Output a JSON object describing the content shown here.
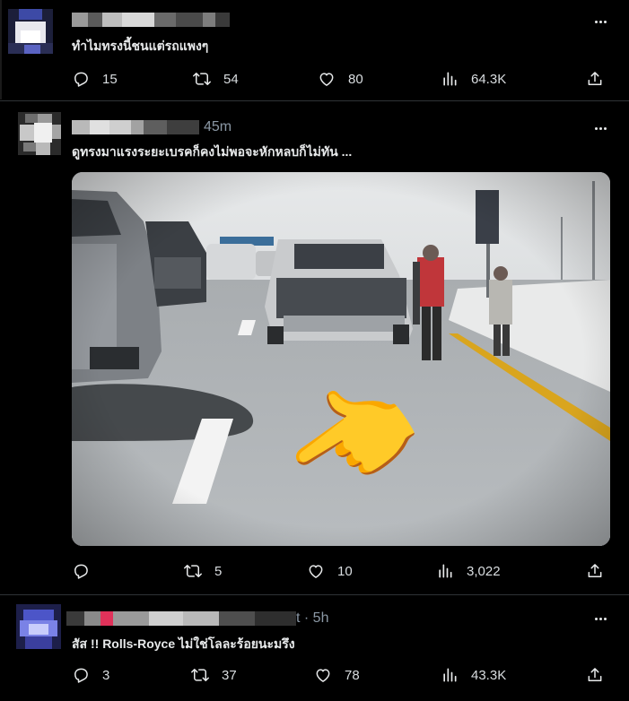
{
  "posts": [
    {
      "time": "",
      "text": "ทำไมทรงนี้ชนแต่รถแพงๆ",
      "actions": {
        "replies": "15",
        "reposts": "54",
        "likes": "80",
        "views": "64.3K"
      }
    },
    {
      "time": "45m",
      "text": "ดูทรงมาแรงระยะเบรคก็คงไม่พอจะหักหลบก็ไม่ทัน ...",
      "media": {
        "pointer_emoji": "👈"
      },
      "actions": {
        "replies": "",
        "reposts": "5",
        "likes": "10",
        "views": "3,022"
      }
    },
    {
      "time": "t · 5h",
      "text": "สัส !! Rolls-Royce ไม่ใช่โลละร้อยนะมรึง",
      "actions": {
        "replies": "3",
        "reposts": "37",
        "likes": "78",
        "views": "43.3K"
      }
    }
  ],
  "icons": {
    "reply": "reply-icon",
    "repost": "repost-icon",
    "like": "heart-icon",
    "views": "views-icon",
    "share": "share-icon",
    "more": "more-icon"
  },
  "colors": {
    "background": "#000000",
    "text": "#e7e9ea",
    "muted": "#8b98a5",
    "divider": "#2f3336"
  }
}
